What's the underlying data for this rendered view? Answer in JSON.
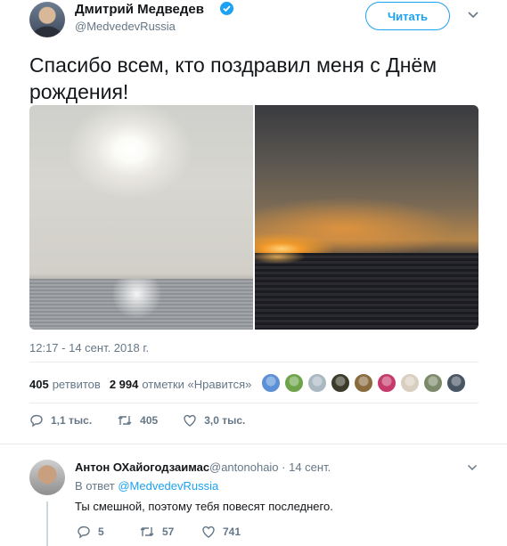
{
  "tweet": {
    "author_name": "Дмитрий Медведев",
    "author_handle": "@MedvedevRussia",
    "follow_label": "Читать",
    "text": "Спасибо всем, кто поздравил меня с Днём рождения!",
    "timestamp": "12:17 - 14 сент. 2018 г.",
    "retweets_count": "405",
    "retweets_label": "ретвитов",
    "likes_count": "2 994",
    "likes_label": "отметки «Нравится»",
    "actions": {
      "replies": "1,1 тыс.",
      "retweets": "405",
      "likes": "3,0 тыс."
    },
    "likers": [
      "#5b8fd6",
      "#6ea34a",
      "#aab8c2",
      "#3c3a2a",
      "#8a6b3e",
      "#c63a6b",
      "#d8cfc0",
      "#7d8a6a",
      "#4a5563"
    ]
  },
  "reply": {
    "author_name": "Антон ОХайогодзаимас",
    "author_handle": "@antonohaio · 14 сент.",
    "in_reply_to_prefix": "В ответ",
    "in_reply_to_handle": "@MedvedevRussia",
    "text": "Ты смешной, поэтому тебя повесят последнего.",
    "actions": {
      "replies": "5",
      "retweets": "57",
      "likes": "741"
    }
  },
  "colors": {
    "accent": "#1da1f2",
    "secondary_text": "#657786",
    "divider": "#e6ecf0"
  }
}
